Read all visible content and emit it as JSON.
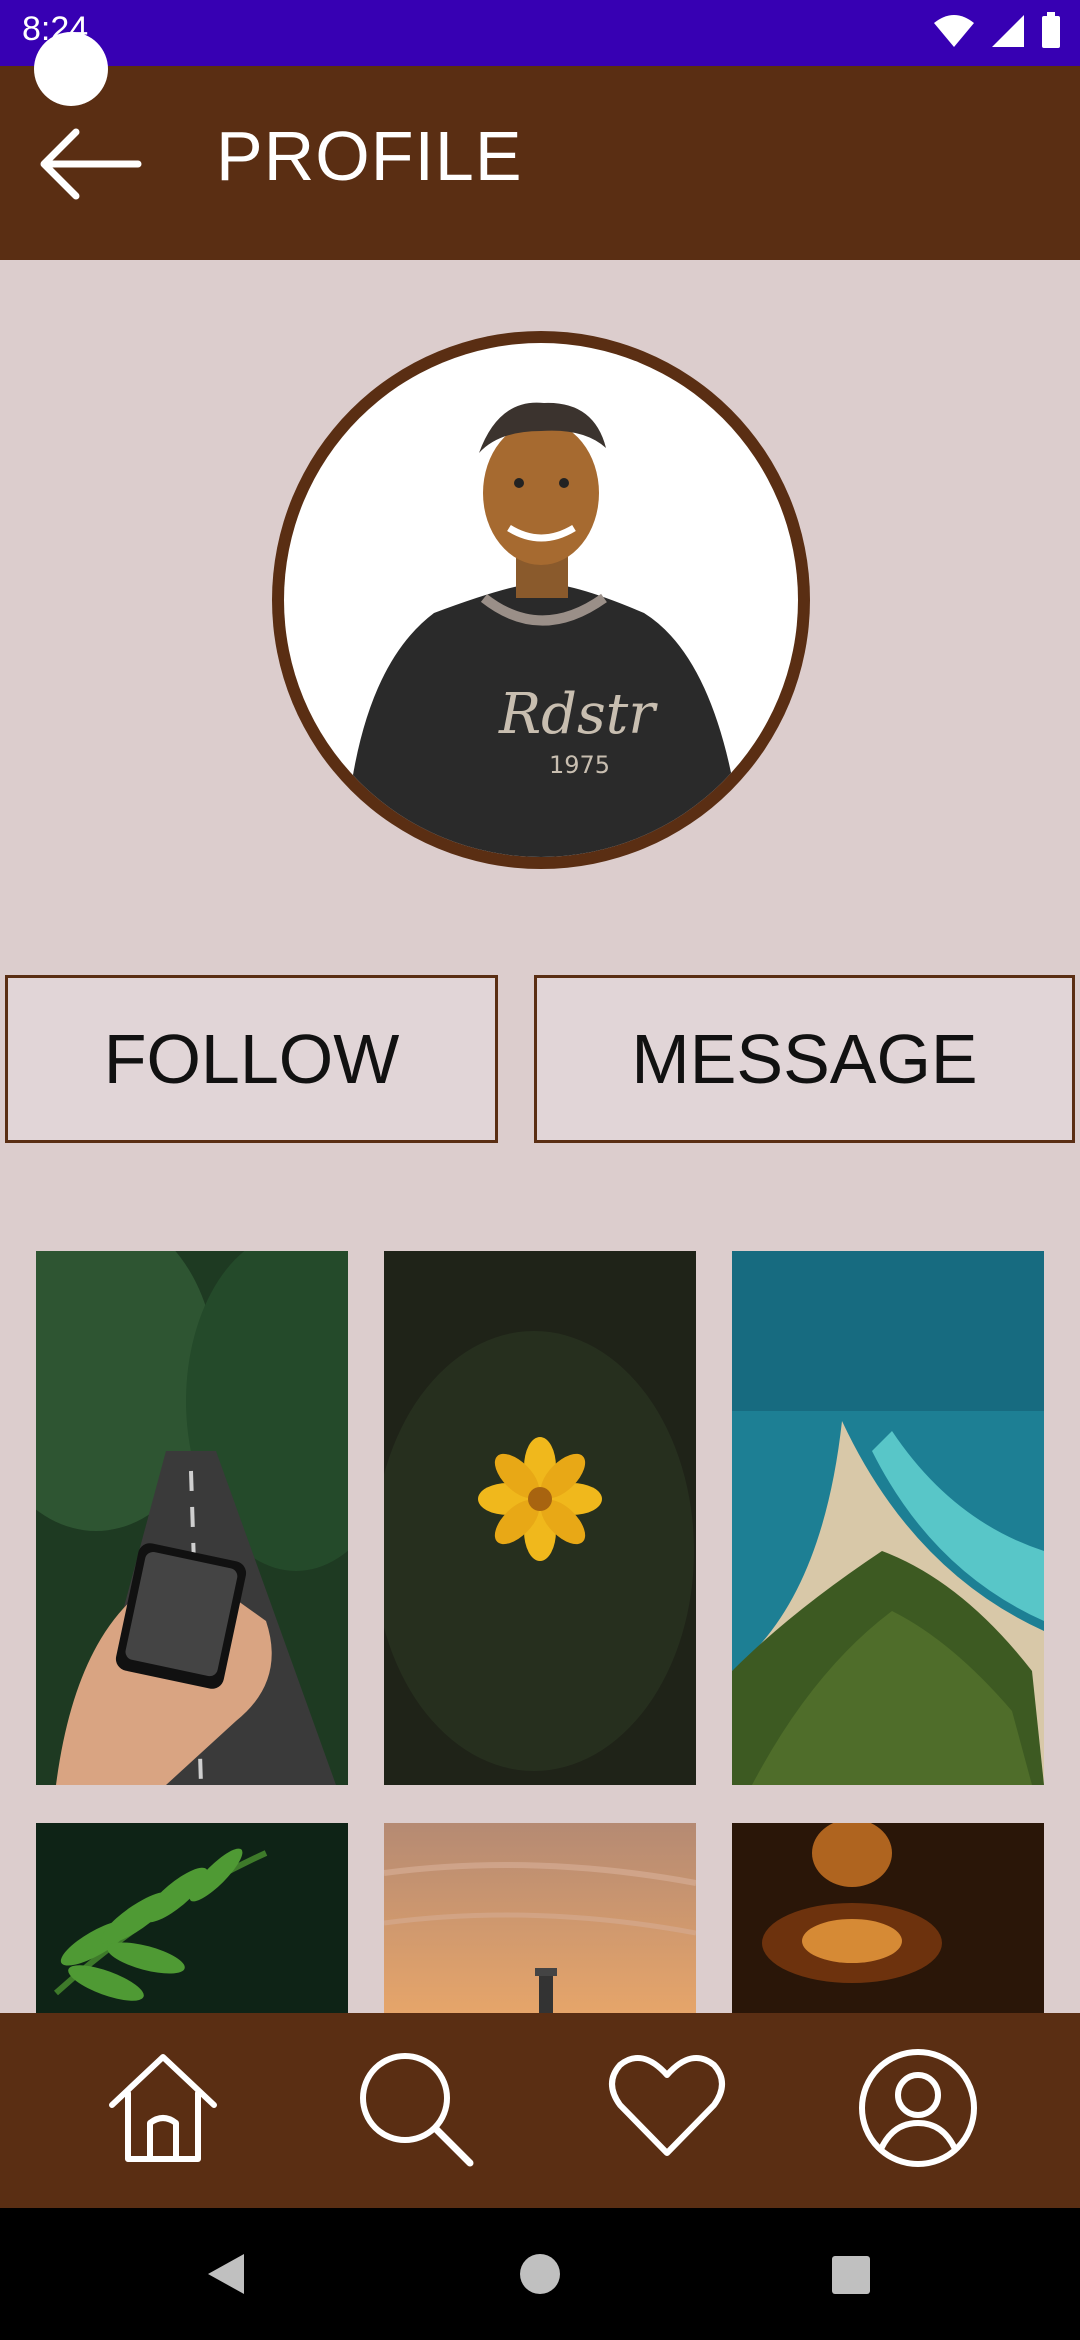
{
  "status_bar": {
    "time": "8:24"
  },
  "app_bar": {
    "title": "PROFILE",
    "back_icon": "arrow-left-icon"
  },
  "buttons": {
    "follow": "FOLLOW",
    "message": "MESSAGE"
  },
  "gallery": {
    "photos": [
      "road-in-phone",
      "yellow-flower",
      "beach-aerial",
      "fern-leaves",
      "sunset-lighthouse",
      "candle-bokeh"
    ]
  },
  "bottom_nav": {
    "items": [
      "home-icon",
      "search-icon",
      "heart-icon",
      "profile-icon"
    ]
  },
  "colors": {
    "status_bar": "#3700b3",
    "primary_brown": "#5a2e13",
    "background": "#dccdcd",
    "button_fill": "#e1d5d7"
  }
}
